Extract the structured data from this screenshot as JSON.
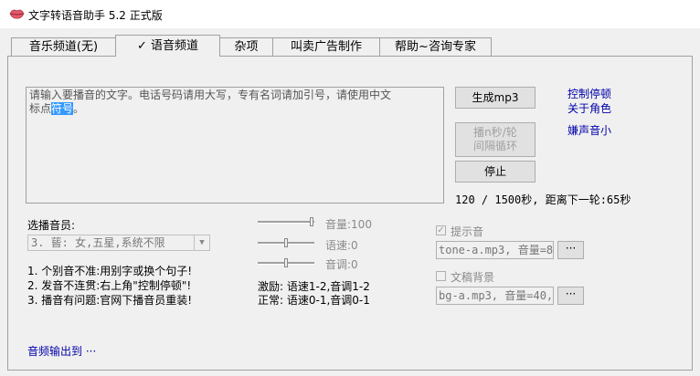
{
  "window": {
    "title": "文字转语音助手 5.2 正式版",
    "icon": "lips-icon"
  },
  "tabs": [
    {
      "label": "音乐频道(无)"
    },
    {
      "label": "✓ 语音频道"
    },
    {
      "label": "杂项"
    },
    {
      "label": "叫卖广告制作"
    },
    {
      "label": "帮助~咨询专家"
    }
  ],
  "text_input": {
    "line1": "请输入要播音的文字。电话号码请用大写，专有名词请加引号，请使用中文",
    "line2_prefix": "标点",
    "line2_selected": "符号",
    "line2_suffix": "。"
  },
  "buttons": {
    "generate": "生成mp3",
    "loop_line1": "播n秒/轮",
    "loop_line2": "间隔循环",
    "stop": "停止"
  },
  "links": {
    "control_pause": "控制停顿",
    "about_role": "关于角色",
    "bg_low": "嫌声音小",
    "audio_output": "音频输出到 ···"
  },
  "status": {
    "progress": "120 / 1500秒, 距离下一轮:65秒"
  },
  "voice": {
    "label": "选播音员:",
    "selected": "3. 蒈: 女,五星,系统不限"
  },
  "tips": [
    "1. 个别音不准:用别字或换个句子!",
    "2. 发音不连贯:右上角\"控制停顿\"!",
    "3. 播音有问题:官网下播音员重装!"
  ],
  "sliders": [
    {
      "label": "音量:100",
      "level": 1.0
    },
    {
      "label": "语速:0",
      "level": 0.5
    },
    {
      "label": "音调:0",
      "level": 0.5
    }
  ],
  "presets": {
    "excited": "激励: 语速1-2,音调1-2",
    "normal": "正常: 语速0-1,音调0-1"
  },
  "prompt_sound": {
    "label": "提示音",
    "checked": true,
    "value": "tone-a.mp3, 音量=8",
    "browse": "···"
  },
  "background": {
    "label": "文稿背景",
    "checked": false,
    "value": "bg-a.mp3, 音量=40,",
    "browse": "···"
  },
  "colors": {
    "link": "#0000aa",
    "selection": "#3399ff"
  }
}
